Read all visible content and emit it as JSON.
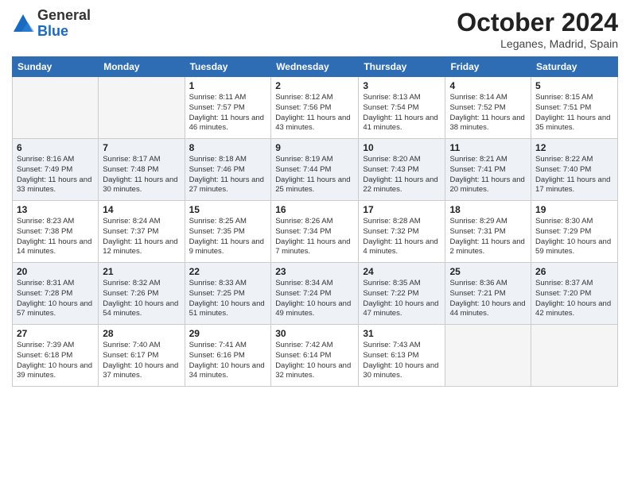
{
  "header": {
    "logo": {
      "general": "General",
      "blue": "Blue"
    },
    "month_year": "October 2024",
    "location": "Leganes, Madrid, Spain"
  },
  "days_of_week": [
    "Sunday",
    "Monday",
    "Tuesday",
    "Wednesday",
    "Thursday",
    "Friday",
    "Saturday"
  ],
  "weeks": [
    [
      {
        "day": "",
        "empty": true
      },
      {
        "day": "",
        "empty": true
      },
      {
        "day": "1",
        "sunrise": "8:11 AM",
        "sunset": "7:57 PM",
        "daylight": "11 hours and 46 minutes."
      },
      {
        "day": "2",
        "sunrise": "8:12 AM",
        "sunset": "7:56 PM",
        "daylight": "11 hours and 43 minutes."
      },
      {
        "day": "3",
        "sunrise": "8:13 AM",
        "sunset": "7:54 PM",
        "daylight": "11 hours and 41 minutes."
      },
      {
        "day": "4",
        "sunrise": "8:14 AM",
        "sunset": "7:52 PM",
        "daylight": "11 hours and 38 minutes."
      },
      {
        "day": "5",
        "sunrise": "8:15 AM",
        "sunset": "7:51 PM",
        "daylight": "11 hours and 35 minutes."
      }
    ],
    [
      {
        "day": "6",
        "sunrise": "8:16 AM",
        "sunset": "7:49 PM",
        "daylight": "11 hours and 33 minutes."
      },
      {
        "day": "7",
        "sunrise": "8:17 AM",
        "sunset": "7:48 PM",
        "daylight": "11 hours and 30 minutes."
      },
      {
        "day": "8",
        "sunrise": "8:18 AM",
        "sunset": "7:46 PM",
        "daylight": "11 hours and 27 minutes."
      },
      {
        "day": "9",
        "sunrise": "8:19 AM",
        "sunset": "7:44 PM",
        "daylight": "11 hours and 25 minutes."
      },
      {
        "day": "10",
        "sunrise": "8:20 AM",
        "sunset": "7:43 PM",
        "daylight": "11 hours and 22 minutes."
      },
      {
        "day": "11",
        "sunrise": "8:21 AM",
        "sunset": "7:41 PM",
        "daylight": "11 hours and 20 minutes."
      },
      {
        "day": "12",
        "sunrise": "8:22 AM",
        "sunset": "7:40 PM",
        "daylight": "11 hours and 17 minutes."
      }
    ],
    [
      {
        "day": "13",
        "sunrise": "8:23 AM",
        "sunset": "7:38 PM",
        "daylight": "11 hours and 14 minutes."
      },
      {
        "day": "14",
        "sunrise": "8:24 AM",
        "sunset": "7:37 PM",
        "daylight": "11 hours and 12 minutes."
      },
      {
        "day": "15",
        "sunrise": "8:25 AM",
        "sunset": "7:35 PM",
        "daylight": "11 hours and 9 minutes."
      },
      {
        "day": "16",
        "sunrise": "8:26 AM",
        "sunset": "7:34 PM",
        "daylight": "11 hours and 7 minutes."
      },
      {
        "day": "17",
        "sunrise": "8:28 AM",
        "sunset": "7:32 PM",
        "daylight": "11 hours and 4 minutes."
      },
      {
        "day": "18",
        "sunrise": "8:29 AM",
        "sunset": "7:31 PM",
        "daylight": "11 hours and 2 minutes."
      },
      {
        "day": "19",
        "sunrise": "8:30 AM",
        "sunset": "7:29 PM",
        "daylight": "10 hours and 59 minutes."
      }
    ],
    [
      {
        "day": "20",
        "sunrise": "8:31 AM",
        "sunset": "7:28 PM",
        "daylight": "10 hours and 57 minutes."
      },
      {
        "day": "21",
        "sunrise": "8:32 AM",
        "sunset": "7:26 PM",
        "daylight": "10 hours and 54 minutes."
      },
      {
        "day": "22",
        "sunrise": "8:33 AM",
        "sunset": "7:25 PM",
        "daylight": "10 hours and 51 minutes."
      },
      {
        "day": "23",
        "sunrise": "8:34 AM",
        "sunset": "7:24 PM",
        "daylight": "10 hours and 49 minutes."
      },
      {
        "day": "24",
        "sunrise": "8:35 AM",
        "sunset": "7:22 PM",
        "daylight": "10 hours and 47 minutes."
      },
      {
        "day": "25",
        "sunrise": "8:36 AM",
        "sunset": "7:21 PM",
        "daylight": "10 hours and 44 minutes."
      },
      {
        "day": "26",
        "sunrise": "8:37 AM",
        "sunset": "7:20 PM",
        "daylight": "10 hours and 42 minutes."
      }
    ],
    [
      {
        "day": "27",
        "sunrise": "7:39 AM",
        "sunset": "6:18 PM",
        "daylight": "10 hours and 39 minutes."
      },
      {
        "day": "28",
        "sunrise": "7:40 AM",
        "sunset": "6:17 PM",
        "daylight": "10 hours and 37 minutes."
      },
      {
        "day": "29",
        "sunrise": "7:41 AM",
        "sunset": "6:16 PM",
        "daylight": "10 hours and 34 minutes."
      },
      {
        "day": "30",
        "sunrise": "7:42 AM",
        "sunset": "6:14 PM",
        "daylight": "10 hours and 32 minutes."
      },
      {
        "day": "31",
        "sunrise": "7:43 AM",
        "sunset": "6:13 PM",
        "daylight": "10 hours and 30 minutes."
      },
      {
        "day": "",
        "empty": true
      },
      {
        "day": "",
        "empty": true
      }
    ]
  ]
}
